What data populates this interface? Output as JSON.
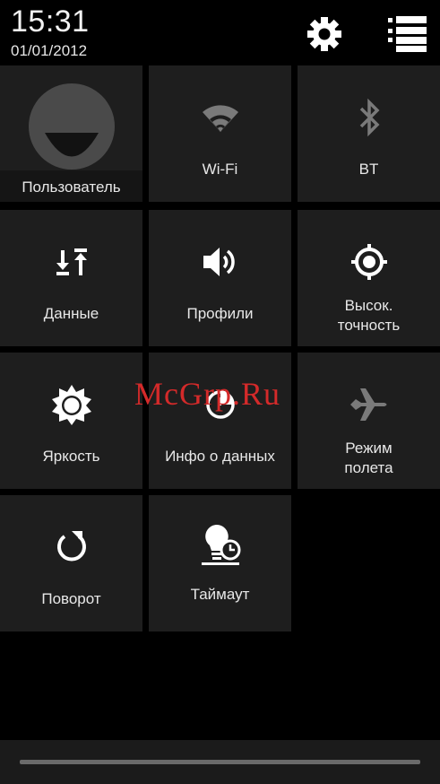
{
  "status": {
    "time": "15:31",
    "date": "01/01/2012"
  },
  "header_icons": {
    "settings": "gear-icon",
    "list": "list-icon"
  },
  "tiles": [
    {
      "label": "Пользователь",
      "icon": "user-avatar-icon"
    },
    {
      "label": "Wi-Fi",
      "icon": "wifi-icon"
    },
    {
      "label": "BT",
      "icon": "bluetooth-icon"
    },
    {
      "label": "Данные",
      "icon": "data-transfer-icon"
    },
    {
      "label": "Профили",
      "icon": "volume-icon"
    },
    {
      "label": "Высок.\nточность",
      "icon": "location-icon"
    },
    {
      "label": "Яркость",
      "icon": "brightness-icon"
    },
    {
      "label": "Инфо о данных",
      "icon": "data-usage-icon"
    },
    {
      "label": "Режим\nполета",
      "icon": "airplane-icon"
    },
    {
      "label": "Поворот",
      "icon": "rotate-icon"
    },
    {
      "label": "Таймаут",
      "icon": "timeout-icon"
    }
  ],
  "watermark": "McGrp.Ru",
  "colors": {
    "tile_bg": "#1e1e1e",
    "bg": "#000000",
    "inactive_icon": "#7a7a7a",
    "active_icon": "#ffffff"
  }
}
